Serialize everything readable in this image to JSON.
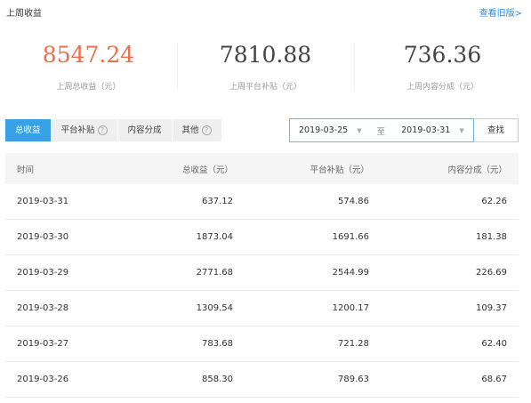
{
  "header": {
    "title": "上周收益",
    "history_link": "查看旧版>"
  },
  "stats": [
    {
      "value": "8547.24",
      "label": "上周总收益（元）"
    },
    {
      "value": "7810.88",
      "label": "上周平台补贴（元）"
    },
    {
      "value": "736.36",
      "label": "上周内容分成（元）"
    }
  ],
  "tabs": [
    {
      "label": "总收益",
      "active": true
    },
    {
      "label": "平台补贴",
      "help": "?"
    },
    {
      "label": "内容分成"
    },
    {
      "label": "其他",
      "help": "?"
    }
  ],
  "date_range": {
    "start": "2019-03-25",
    "separator": "至",
    "end": "2019-03-31",
    "caret_icon": "caret-down-icon"
  },
  "search_button": "查找",
  "table": {
    "headers": [
      "时间",
      "总收益（元）",
      "平台补贴（元）",
      "内容分成（元）"
    ],
    "rows": [
      [
        "2019-03-31",
        "637.12",
        "574.86",
        "62.26"
      ],
      [
        "2019-03-30",
        "1873.04",
        "1691.66",
        "181.38"
      ],
      [
        "2019-03-29",
        "2771.68",
        "2544.99",
        "226.69"
      ],
      [
        "2019-03-28",
        "1309.54",
        "1200.17",
        "109.37"
      ],
      [
        "2019-03-27",
        "783.68",
        "721.28",
        "62.40"
      ],
      [
        "2019-03-26",
        "858.30",
        "789.63",
        "68.67"
      ]
    ]
  },
  "colors": {
    "accent": "#e8704f",
    "active_tab": "#38a0e6",
    "link": "#2f88e0"
  }
}
